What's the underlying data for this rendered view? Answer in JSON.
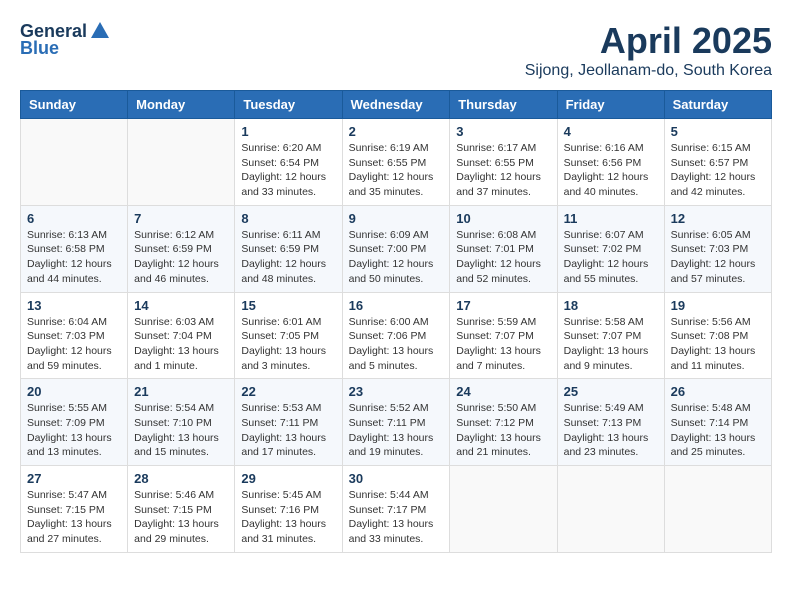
{
  "logo": {
    "general": "General",
    "blue": "Blue"
  },
  "title": "April 2025",
  "location": "Sijong, Jeollanam-do, South Korea",
  "headers": [
    "Sunday",
    "Monday",
    "Tuesday",
    "Wednesday",
    "Thursday",
    "Friday",
    "Saturday"
  ],
  "weeks": [
    [
      {
        "day": "",
        "sunrise": "",
        "sunset": "",
        "daylight": ""
      },
      {
        "day": "",
        "sunrise": "",
        "sunset": "",
        "daylight": ""
      },
      {
        "day": "1",
        "sunrise": "Sunrise: 6:20 AM",
        "sunset": "Sunset: 6:54 PM",
        "daylight": "Daylight: 12 hours and 33 minutes."
      },
      {
        "day": "2",
        "sunrise": "Sunrise: 6:19 AM",
        "sunset": "Sunset: 6:55 PM",
        "daylight": "Daylight: 12 hours and 35 minutes."
      },
      {
        "day": "3",
        "sunrise": "Sunrise: 6:17 AM",
        "sunset": "Sunset: 6:55 PM",
        "daylight": "Daylight: 12 hours and 37 minutes."
      },
      {
        "day": "4",
        "sunrise": "Sunrise: 6:16 AM",
        "sunset": "Sunset: 6:56 PM",
        "daylight": "Daylight: 12 hours and 40 minutes."
      },
      {
        "day": "5",
        "sunrise": "Sunrise: 6:15 AM",
        "sunset": "Sunset: 6:57 PM",
        "daylight": "Daylight: 12 hours and 42 minutes."
      }
    ],
    [
      {
        "day": "6",
        "sunrise": "Sunrise: 6:13 AM",
        "sunset": "Sunset: 6:58 PM",
        "daylight": "Daylight: 12 hours and 44 minutes."
      },
      {
        "day": "7",
        "sunrise": "Sunrise: 6:12 AM",
        "sunset": "Sunset: 6:59 PM",
        "daylight": "Daylight: 12 hours and 46 minutes."
      },
      {
        "day": "8",
        "sunrise": "Sunrise: 6:11 AM",
        "sunset": "Sunset: 6:59 PM",
        "daylight": "Daylight: 12 hours and 48 minutes."
      },
      {
        "day": "9",
        "sunrise": "Sunrise: 6:09 AM",
        "sunset": "Sunset: 7:00 PM",
        "daylight": "Daylight: 12 hours and 50 minutes."
      },
      {
        "day": "10",
        "sunrise": "Sunrise: 6:08 AM",
        "sunset": "Sunset: 7:01 PM",
        "daylight": "Daylight: 12 hours and 52 minutes."
      },
      {
        "day": "11",
        "sunrise": "Sunrise: 6:07 AM",
        "sunset": "Sunset: 7:02 PM",
        "daylight": "Daylight: 12 hours and 55 minutes."
      },
      {
        "day": "12",
        "sunrise": "Sunrise: 6:05 AM",
        "sunset": "Sunset: 7:03 PM",
        "daylight": "Daylight: 12 hours and 57 minutes."
      }
    ],
    [
      {
        "day": "13",
        "sunrise": "Sunrise: 6:04 AM",
        "sunset": "Sunset: 7:03 PM",
        "daylight": "Daylight: 12 hours and 59 minutes."
      },
      {
        "day": "14",
        "sunrise": "Sunrise: 6:03 AM",
        "sunset": "Sunset: 7:04 PM",
        "daylight": "Daylight: 13 hours and 1 minute."
      },
      {
        "day": "15",
        "sunrise": "Sunrise: 6:01 AM",
        "sunset": "Sunset: 7:05 PM",
        "daylight": "Daylight: 13 hours and 3 minutes."
      },
      {
        "day": "16",
        "sunrise": "Sunrise: 6:00 AM",
        "sunset": "Sunset: 7:06 PM",
        "daylight": "Daylight: 13 hours and 5 minutes."
      },
      {
        "day": "17",
        "sunrise": "Sunrise: 5:59 AM",
        "sunset": "Sunset: 7:07 PM",
        "daylight": "Daylight: 13 hours and 7 minutes."
      },
      {
        "day": "18",
        "sunrise": "Sunrise: 5:58 AM",
        "sunset": "Sunset: 7:07 PM",
        "daylight": "Daylight: 13 hours and 9 minutes."
      },
      {
        "day": "19",
        "sunrise": "Sunrise: 5:56 AM",
        "sunset": "Sunset: 7:08 PM",
        "daylight": "Daylight: 13 hours and 11 minutes."
      }
    ],
    [
      {
        "day": "20",
        "sunrise": "Sunrise: 5:55 AM",
        "sunset": "Sunset: 7:09 PM",
        "daylight": "Daylight: 13 hours and 13 minutes."
      },
      {
        "day": "21",
        "sunrise": "Sunrise: 5:54 AM",
        "sunset": "Sunset: 7:10 PM",
        "daylight": "Daylight: 13 hours and 15 minutes."
      },
      {
        "day": "22",
        "sunrise": "Sunrise: 5:53 AM",
        "sunset": "Sunset: 7:11 PM",
        "daylight": "Daylight: 13 hours and 17 minutes."
      },
      {
        "day": "23",
        "sunrise": "Sunrise: 5:52 AM",
        "sunset": "Sunset: 7:11 PM",
        "daylight": "Daylight: 13 hours and 19 minutes."
      },
      {
        "day": "24",
        "sunrise": "Sunrise: 5:50 AM",
        "sunset": "Sunset: 7:12 PM",
        "daylight": "Daylight: 13 hours and 21 minutes."
      },
      {
        "day": "25",
        "sunrise": "Sunrise: 5:49 AM",
        "sunset": "Sunset: 7:13 PM",
        "daylight": "Daylight: 13 hours and 23 minutes."
      },
      {
        "day": "26",
        "sunrise": "Sunrise: 5:48 AM",
        "sunset": "Sunset: 7:14 PM",
        "daylight": "Daylight: 13 hours and 25 minutes."
      }
    ],
    [
      {
        "day": "27",
        "sunrise": "Sunrise: 5:47 AM",
        "sunset": "Sunset: 7:15 PM",
        "daylight": "Daylight: 13 hours and 27 minutes."
      },
      {
        "day": "28",
        "sunrise": "Sunrise: 5:46 AM",
        "sunset": "Sunset: 7:15 PM",
        "daylight": "Daylight: 13 hours and 29 minutes."
      },
      {
        "day": "29",
        "sunrise": "Sunrise: 5:45 AM",
        "sunset": "Sunset: 7:16 PM",
        "daylight": "Daylight: 13 hours and 31 minutes."
      },
      {
        "day": "30",
        "sunrise": "Sunrise: 5:44 AM",
        "sunset": "Sunset: 7:17 PM",
        "daylight": "Daylight: 13 hours and 33 minutes."
      },
      {
        "day": "",
        "sunrise": "",
        "sunset": "",
        "daylight": ""
      },
      {
        "day": "",
        "sunrise": "",
        "sunset": "",
        "daylight": ""
      },
      {
        "day": "",
        "sunrise": "",
        "sunset": "",
        "daylight": ""
      }
    ]
  ]
}
